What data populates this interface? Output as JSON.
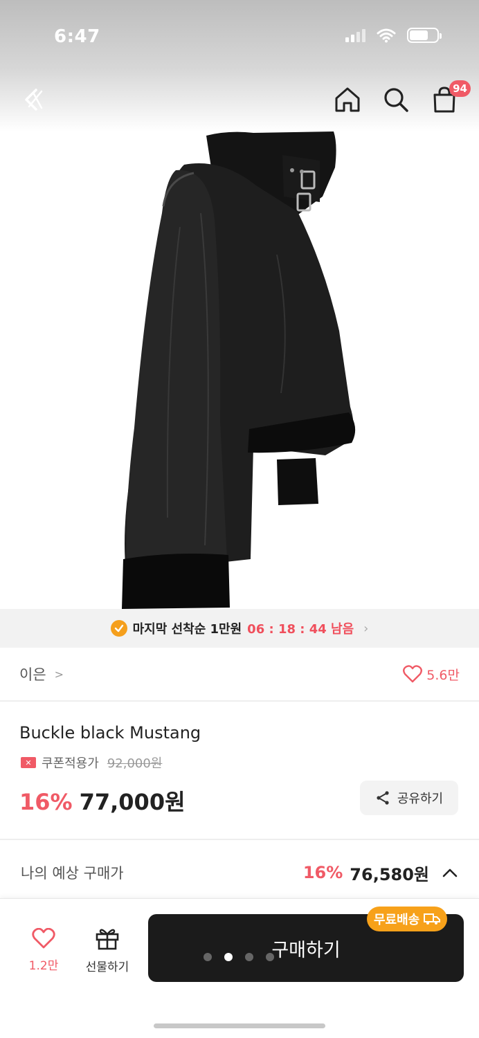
{
  "status_bar": {
    "time": "6:47"
  },
  "nav": {
    "cart_count": "94"
  },
  "timer_banner": {
    "text": "마지막 선착순 1만원",
    "countdown": "06 : 18 : 44 남음"
  },
  "brand": {
    "name": "이은",
    "likes": "5.6만"
  },
  "product": {
    "title": "Buckle black Mustang",
    "coupon_label": "쿠폰적용가",
    "original_price": "92,000원",
    "discount": "16%",
    "price": "77,000원"
  },
  "share": {
    "label": "공유하기"
  },
  "expected": {
    "label": "나의 예상 구매가",
    "discount": "16%",
    "price": "76,580원"
  },
  "bottom_bar": {
    "like_count": "1.2만",
    "gift_label": "선물하기",
    "buy_label": "구매하기",
    "free_shipping": "무료배송"
  },
  "image_pager": {
    "count": 4,
    "active": 2
  },
  "colors": {
    "accent": "#f05a66",
    "badge_orange": "#f7a11a",
    "buy_button": "#1b1b1b"
  }
}
